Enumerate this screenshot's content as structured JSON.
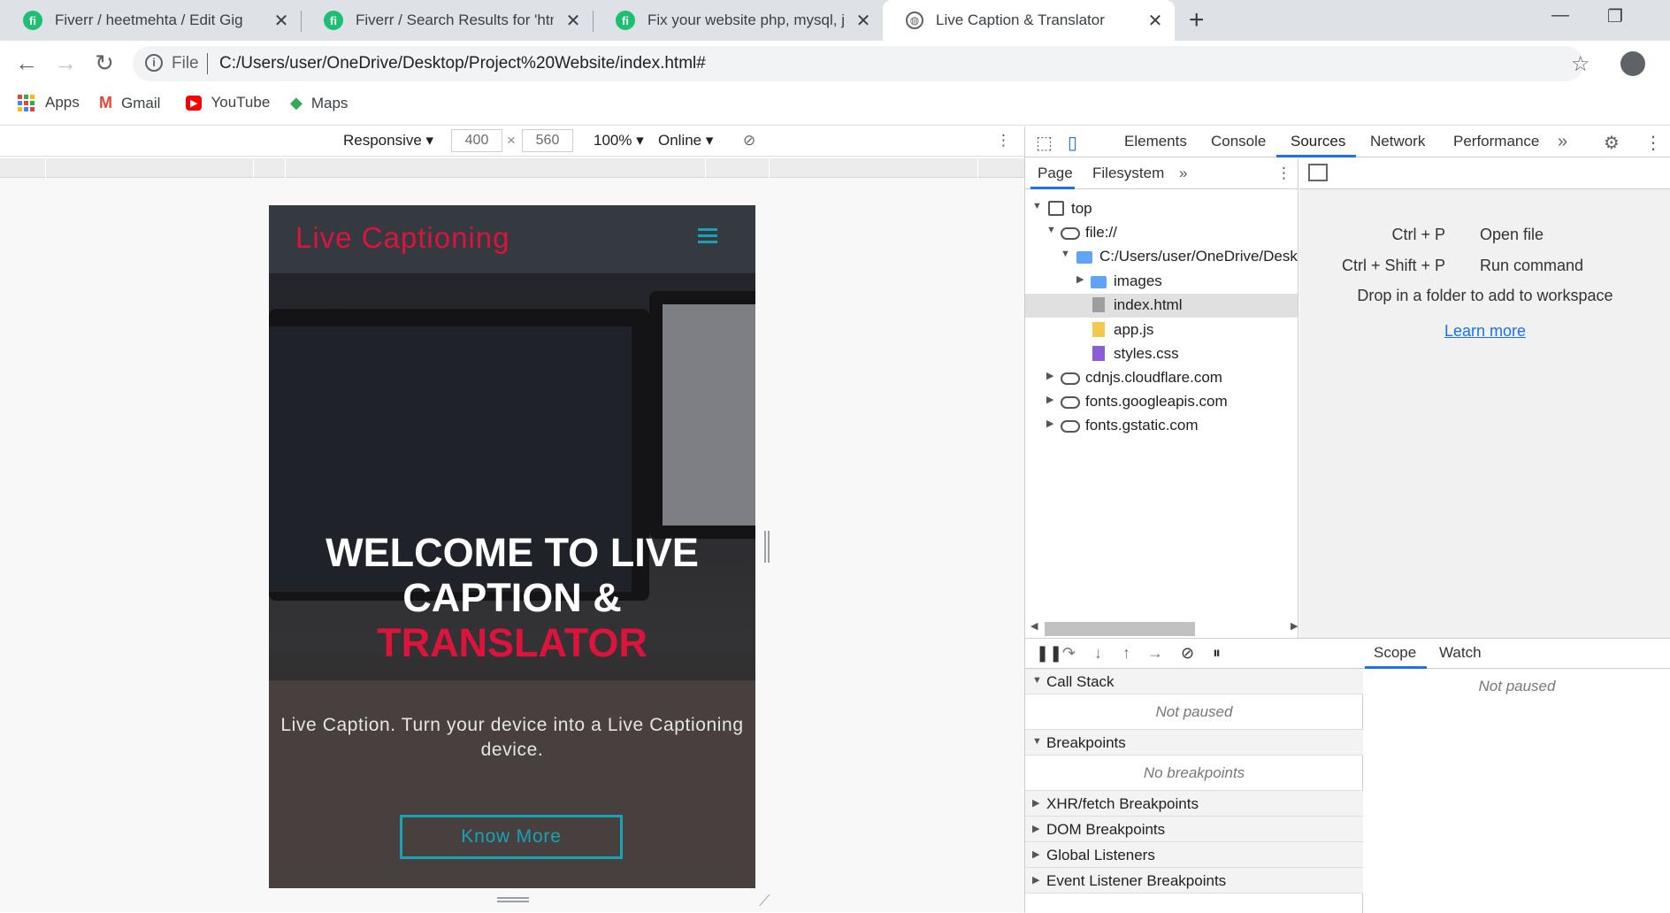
{
  "tabs": [
    {
      "title": "Fiverr / heetmehta / Edit Gig",
      "favicon": "fiverr-icon"
    },
    {
      "title": "Fiverr / Search Results for 'html e",
      "favicon": "fiverr-icon"
    },
    {
      "title": "Fix your website php, mysql, java",
      "favicon": "fiverr-icon"
    },
    {
      "title": "Live Caption & Translator",
      "favicon": "globe-icon"
    }
  ],
  "address": {
    "scheme": "File",
    "url": "C:/Users/user/OneDrive/Desktop/Project%20Website/index.html#"
  },
  "bookmarks": [
    "Apps",
    "Gmail",
    "YouTube",
    "Maps"
  ],
  "device_toolbar": {
    "mode": "Responsive",
    "width": "400",
    "height": "560",
    "zoom": "100%",
    "network": "Online"
  },
  "site": {
    "logo": "Live Captioning",
    "hero_line1": "WELCOME TO LIVE",
    "hero_line2": "CAPTION &",
    "hero_line3": "TRANSLATOR",
    "subtitle": "Live Caption. Turn your device into a Live Captioning device.",
    "cta": "Know More",
    "accent_color": "#dc143c",
    "cta_color": "#17a2b8"
  },
  "devtools": {
    "tabs": [
      "Elements",
      "Console",
      "Sources",
      "Network",
      "Performance"
    ],
    "active_tab": "Sources",
    "nav_tabs": [
      "Page",
      "Filesystem"
    ],
    "tree": [
      {
        "label": "top",
        "icon": "frame-icon"
      },
      {
        "label": "file://",
        "icon": "cloud-icon"
      },
      {
        "label": "C:/Users/user/OneDrive/Desktop",
        "icon": "folder-icon"
      },
      {
        "label": "images",
        "icon": "folder-icon"
      },
      {
        "label": "index.html",
        "icon": "file-html-icon"
      },
      {
        "label": "app.js",
        "icon": "file-js-icon"
      },
      {
        "label": "styles.css",
        "icon": "file-css-icon"
      },
      {
        "label": "cdnjs.cloudflare.com",
        "icon": "cloud-icon"
      },
      {
        "label": "fonts.googleapis.com",
        "icon": "cloud-icon"
      },
      {
        "label": "fonts.gstatic.com",
        "icon": "cloud-icon"
      }
    ],
    "shortcuts": [
      {
        "keys": "Ctrl + P",
        "action": "Open file"
      },
      {
        "keys": "Ctrl + Shift + P",
        "action": "Run command"
      }
    ],
    "drop_msg": "Drop in a folder to add to workspace",
    "learn_more": "Learn more",
    "sections": {
      "call_stack": "Call Stack",
      "call_stack_msg": "Not paused",
      "breakpoints": "Breakpoints",
      "breakpoints_msg": "No breakpoints",
      "xhr": "XHR/fetch Breakpoints",
      "dom": "DOM Breakpoints",
      "global": "Global Listeners",
      "event": "Event Listener Breakpoints"
    },
    "scope_tabs": [
      "Scope",
      "Watch"
    ],
    "scope_msg": "Not paused"
  }
}
